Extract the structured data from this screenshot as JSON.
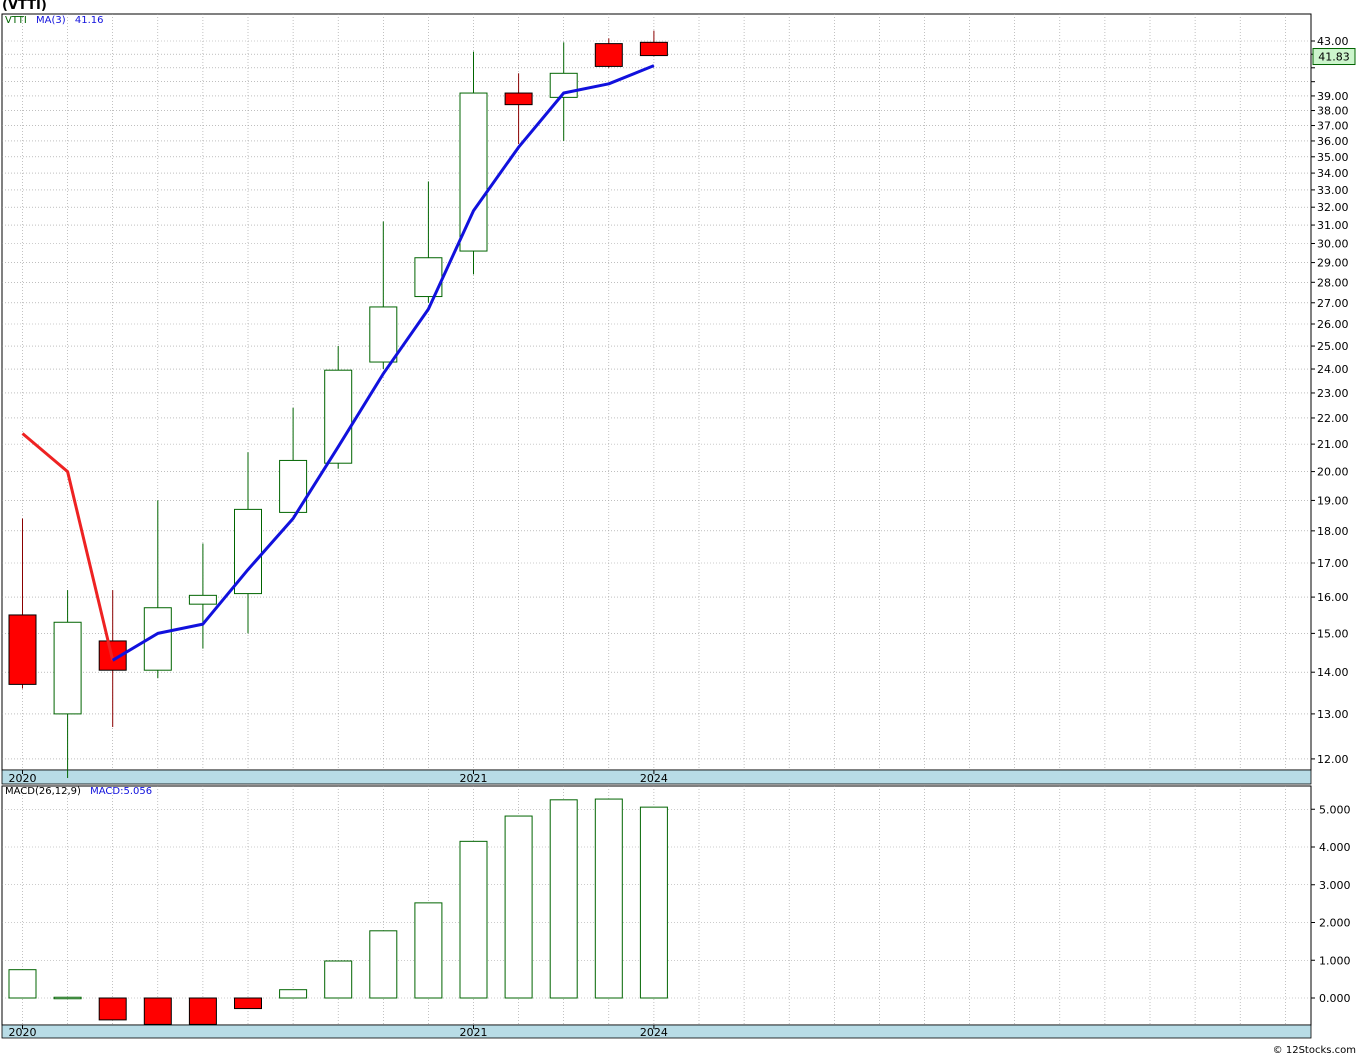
{
  "title": "(VTTI)",
  "price_legend": {
    "symbol": "VTTI",
    "ma_label": "MA(3)",
    "ma_value": "41.16"
  },
  "macd_legend": {
    "label": "MACD(26,12,9)",
    "value_label": "MACD:5.056"
  },
  "last_price_tag": "41.83",
  "copyright": "© 12Stocks.com",
  "colors": {
    "up_border": "#006400",
    "down_fill": "#ff0000",
    "down_border": "#000000",
    "ma_early": "#ee2222",
    "ma_main": "#1111dd",
    "axis_band": "#b8dce6",
    "grid": "#999999",
    "price_tag_bg": "#ccf5cc"
  },
  "chart_data": [
    {
      "type": "candlestick",
      "scale": "log",
      "ylim": [
        11.6,
        44
      ],
      "y_ticks": [
        "12.00",
        "13.00",
        "14.00",
        "15.00",
        "16.00",
        "17.00",
        "18.00",
        "19.00",
        "20.00",
        "21.00",
        "22.00",
        "23.00",
        "24.00",
        "25.00",
        "26.00",
        "27.00",
        "28.00",
        "29.00",
        "30.00",
        "31.00",
        "32.00",
        "33.00",
        "34.00",
        "35.00",
        "36.00",
        "37.00",
        "38.00",
        "39.00",
        "40.00",
        "41.00",
        "42.00",
        "43.00"
      ],
      "y_tick_labels_shown": [
        "12.00",
        "13.00",
        "14.00",
        "15.00",
        "16.00",
        "17.00",
        "18.00",
        "19.00",
        "20.00",
        "21.00",
        "22.00",
        "23.00",
        "24.00",
        "25.00",
        "26.00",
        "27.00",
        "28.00",
        "29.00",
        "30.00",
        "31.00",
        "32.00",
        "33.00",
        "34.00",
        "35.00",
        "36.00",
        "37.00",
        "38.00",
        "39.00",
        "43.00"
      ],
      "x_labels": [
        {
          "index": 0,
          "label": "2020"
        },
        {
          "index": 10,
          "label": "2021"
        },
        {
          "index": 14,
          "label": "2024"
        }
      ],
      "candles": [
        {
          "open": 15.5,
          "high": 18.4,
          "low": 13.6,
          "close": 13.7
        },
        {
          "open": 13.0,
          "high": 16.2,
          "low": 11.6,
          "close": 15.3
        },
        {
          "open": 14.8,
          "high": 16.2,
          "low": 12.7,
          "close": 14.05
        },
        {
          "open": 14.05,
          "high": 19.0,
          "low": 13.85,
          "close": 15.7
        },
        {
          "open": 15.8,
          "high": 17.6,
          "low": 14.6,
          "close": 16.05
        },
        {
          "open": 16.1,
          "high": 20.7,
          "low": 15.0,
          "close": 18.7
        },
        {
          "open": 18.6,
          "high": 22.4,
          "low": 18.6,
          "close": 20.4
        },
        {
          "open": 20.3,
          "high": 25.0,
          "low": 20.1,
          "close": 23.95
        },
        {
          "open": 24.3,
          "high": 31.2,
          "low": 24.0,
          "close": 26.8
        },
        {
          "open": 27.3,
          "high": 33.5,
          "low": 27.0,
          "close": 29.25
        },
        {
          "open": 29.6,
          "high": 42.2,
          "low": 28.4,
          "close": 39.2
        },
        {
          "open": 39.2,
          "high": 40.6,
          "low": 35.8,
          "close": 38.4
        },
        {
          "open": 38.9,
          "high": 42.9,
          "low": 36.0,
          "close": 40.6
        },
        {
          "open": 42.8,
          "high": 43.2,
          "low": 41.0,
          "close": 41.1
        },
        {
          "open": 42.9,
          "high": 43.8,
          "low": 41.85,
          "close": 41.9
        }
      ],
      "ma_series": [
        {
          "name": "MA(3)",
          "start_index": 0,
          "values": [
            21.4,
            20.0,
            14.3
          ],
          "color_key": "ma_early"
        },
        {
          "name": "MA(3)",
          "start_index": 2,
          "values": [
            14.3,
            15.0,
            15.25,
            16.8,
            18.4,
            20.9,
            23.8,
            26.7,
            31.8,
            35.6,
            39.2,
            39.85,
            41.16
          ],
          "color_key": "ma_main"
        }
      ],
      "last_price": 41.83
    },
    {
      "type": "bar",
      "name": "MACD(26,12,9)",
      "ylim": [
        -0.7,
        5.5
      ],
      "y_ticks": [
        "0.000",
        "1.000",
        "2.000",
        "3.000",
        "4.000",
        "5.000"
      ],
      "x_labels": [
        {
          "index": 0,
          "label": "2020"
        },
        {
          "index": 10,
          "label": "2021"
        },
        {
          "index": 14,
          "label": "2024"
        }
      ],
      "values": [
        0.75,
        0.02,
        -0.58,
        -0.7,
        -0.7,
        -0.28,
        0.22,
        0.98,
        1.78,
        2.52,
        4.15,
        4.82,
        5.25,
        5.27,
        5.056
      ]
    }
  ]
}
